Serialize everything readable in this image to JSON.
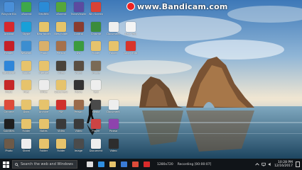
{
  "watermark": {
    "text": "www.Bandicam.com"
  },
  "desktop_icons": [
    {
      "label": "Recycle Bin",
      "color": "#4a8fd8",
      "c": 0,
      "r": 0
    },
    {
      "label": "uTorrent",
      "color": "#3ea84b",
      "c": 1,
      "r": 0
    },
    {
      "label": "SHAREit",
      "color": "#2a8bd6",
      "c": 2,
      "r": 0
    },
    {
      "label": "uTorrent",
      "color": "#55a63c",
      "c": 3,
      "r": 0
    },
    {
      "label": "TeamViewer",
      "color": "#5b4ba0",
      "c": 4,
      "r": 0
    },
    {
      "label": "Win Screen",
      "color": "#d94336",
      "c": 5,
      "r": 0
    },
    {
      "label": "Acrobat",
      "color": "#d7282c",
      "c": 0,
      "r": 1
    },
    {
      "label": "Skype",
      "color": "#18a0d8",
      "c": 1,
      "r": 1
    },
    {
      "label": "New folder",
      "color": "#e5c46a",
      "c": 2,
      "r": 1
    },
    {
      "label": "New folder",
      "color": "#e5c46a",
      "c": 3,
      "r": 1
    },
    {
      "label": "Control",
      "color": "#8a3c30",
      "c": 4,
      "r": 1
    },
    {
      "label": "Chrome",
      "color": "#3b8c3b",
      "c": 5,
      "r": 1
    },
    {
      "label": "Document",
      "color": "#eeeeee",
      "c": 6,
      "r": 1
    },
    {
      "label": "New Text",
      "color": "#f4f4f4",
      "c": 7,
      "r": 1
    },
    {
      "label": "Reader",
      "color": "#c52028",
      "c": 0,
      "r": 2
    },
    {
      "label": "Network",
      "color": "#3c8ed0",
      "c": 1,
      "r": 2
    },
    {
      "label": "Photo",
      "color": "#d9b06b",
      "c": 2,
      "r": 2
    },
    {
      "label": "Person",
      "color": "#a5714c",
      "c": 3,
      "r": 2
    },
    {
      "label": "Dw",
      "color": "#3b9b3e",
      "c": 4,
      "r": 2
    },
    {
      "label": "Folder",
      "color": "#e6c36c",
      "c": 5,
      "r": 2
    },
    {
      "label": "Folder",
      "color": "#e6c36c",
      "c": 6,
      "r": 2
    },
    {
      "label": "Angry Bird",
      "color": "#d8342b",
      "c": 7,
      "r": 2
    },
    {
      "label": "Bandicam",
      "color": "#2f86d9",
      "c": 0,
      "r": 3
    },
    {
      "label": "Adobe",
      "color": "#e6c36c",
      "c": 1,
      "r": 3
    },
    {
      "label": "Internet",
      "color": "#e6c36c",
      "c": 2,
      "r": 3
    },
    {
      "label": "Video",
      "color": "#49433b",
      "c": 3,
      "r": 3
    },
    {
      "label": "Video",
      "color": "#5a4e42",
      "c": 4,
      "r": 3
    },
    {
      "label": "Image",
      "color": "#7a6a55",
      "c": 5,
      "r": 3
    },
    {
      "label": "Music",
      "color": "#c62828",
      "c": 0,
      "r": 4
    },
    {
      "label": "Files",
      "color": "#e6c36c",
      "c": 1,
      "r": 4
    },
    {
      "label": "Office",
      "color": "#ececec",
      "c": 2,
      "r": 4
    },
    {
      "label": "Document",
      "color": "#e6c36c",
      "c": 3,
      "r": 4
    },
    {
      "label": "Movie",
      "color": "#333333",
      "c": 4,
      "r": 4
    },
    {
      "label": "Text",
      "color": "#eeeeee",
      "c": 5,
      "r": 4
    },
    {
      "label": "Chrome",
      "color": "#dd4b39",
      "c": 0,
      "r": 5
    },
    {
      "label": "Docs",
      "color": "#e6c36c",
      "c": 1,
      "r": 5
    },
    {
      "label": "Archive",
      "color": "#e6c36c",
      "c": 2,
      "r": 5
    },
    {
      "label": "PDF",
      "color": "#d0312d",
      "c": 3,
      "r": 5
    },
    {
      "label": "Person",
      "color": "#9a6b4a",
      "c": 4,
      "r": 5
    },
    {
      "label": "Media",
      "color": "#4a4a4a",
      "c": 5,
      "r": 5
    },
    {
      "label": "Document",
      "color": "#eeeeee",
      "c": 6,
      "r": 5
    },
    {
      "label": "Subtitles",
      "color": "#1f1f1f",
      "c": 0,
      "r": 6
    },
    {
      "label": "Folder",
      "color": "#e6c36c",
      "c": 1,
      "r": 6
    },
    {
      "label": "Notes",
      "color": "#e6c36c",
      "c": 2,
      "r": 6
    },
    {
      "label": "Video",
      "color": "#3a3a3a",
      "c": 3,
      "r": 6
    },
    {
      "label": "Video",
      "color": "#3a3a3a",
      "c": 4,
      "r": 6
    },
    {
      "label": "Player",
      "color": "#c44",
      "c": 5,
      "r": 6
    },
    {
      "label": "Picasa",
      "color": "#8e44ad",
      "c": 6,
      "r": 6
    },
    {
      "label": "Photo",
      "color": "#6d5a48",
      "c": 0,
      "r": 7
    },
    {
      "label": "Sheet",
      "color": "#eeeeee",
      "c": 1,
      "r": 7
    },
    {
      "label": "Folder",
      "color": "#e6c36c",
      "c": 2,
      "r": 7
    },
    {
      "label": "Folder",
      "color": "#e6c36c",
      "c": 3,
      "r": 7
    },
    {
      "label": "Image",
      "color": "#4b4b4b",
      "c": 4,
      "r": 7
    },
    {
      "label": "Document",
      "color": "#eeeeee",
      "c": 5,
      "r": 7
    },
    {
      "label": "Video",
      "color": "#2d2d2d",
      "c": 6,
      "r": 7
    }
  ],
  "taskbar": {
    "search_placeholder": "Search the web and Windows",
    "apps": [
      {
        "name": "task-view-icon",
        "color": "#dddddd"
      },
      {
        "name": "edge-icon",
        "color": "#2f8fe0"
      },
      {
        "name": "file-explorer-icon",
        "color": "#e6c36c"
      },
      {
        "name": "store-icon",
        "color": "#3a7bd5"
      },
      {
        "name": "chrome-icon",
        "color": "#dd4b39"
      },
      {
        "name": "bandicam-icon",
        "color": "#d92b2b"
      }
    ],
    "recording_size": "1280x720",
    "recording_label": "Recording [00:00:07]",
    "time": "10:28 PM",
    "date": "12/16/2017"
  }
}
